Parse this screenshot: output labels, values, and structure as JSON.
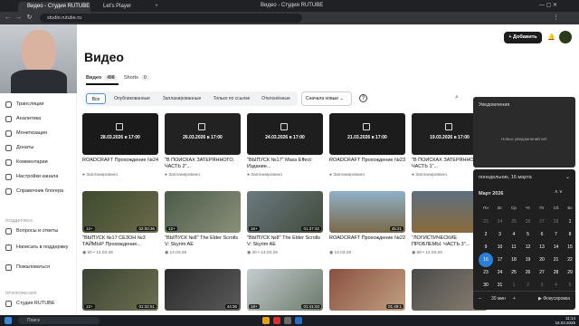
{
  "browser": {
    "tabs": [
      {
        "label": "Видео - Студия RUTUBE"
      },
      {
        "label": "Let's Player"
      }
    ],
    "address": "studio.rutube.ru",
    "page_title": "Видео - Студия RUTUBE"
  },
  "header": {
    "add_label": "+ Добавить"
  },
  "page": {
    "title": "Видео"
  },
  "subtabs": [
    {
      "label": "Видео",
      "count": "498"
    },
    {
      "label": "Shorts",
      "count": "0"
    }
  ],
  "filters": [
    "Все",
    "Опубликованные",
    "Запланированные",
    "Только по ссылке",
    "Отклонённые"
  ],
  "sort": {
    "label": "Сначала новые"
  },
  "sidebar": {
    "items": [
      "Трансляции",
      "Аналитика",
      "Монетизация",
      "Донаты",
      "Комментарии",
      "Настройки канала",
      "Справочник блогера"
    ],
    "support_head": "ПОДДЕРЖКА",
    "support": [
      "Вопросы и ответы",
      "Написать в поддержку",
      "Пожаловаться"
    ],
    "apps_head": "ПРИЛОЖЕНИЯ",
    "apps": [
      "Студия RUTUBE"
    ]
  },
  "row1": [
    {
      "date": "28.03.2026 в 17:00",
      "title": "ROADCRAFT Прохождение №24",
      "meta": "● Запланировано"
    },
    {
      "date": "26.03.2026 в 17:00",
      "title": "\"В ПОИСКАХ ЗАТЕРЯННОГО. ЧАСТЬ 2\"...",
      "meta": "● Запланировано"
    },
    {
      "date": "24.03.2026 в 17:00",
      "title": "\"ВЫПУСК №17\" Mass Effect: Издание...",
      "meta": "● Запланировано"
    },
    {
      "date": "21.03.2026 в 17:00",
      "title": "ROADCRAFT Прохождение №23",
      "meta": "● Запланировано"
    },
    {
      "date": "19.03.2026 в 17:00",
      "title": "\"В ПОИСКАХ ЗАТЕРЯННОГО. ЧАСТЬ 1\"...",
      "meta": "● Запланировано"
    }
  ],
  "row2": [
    {
      "age": "12+",
      "dur": "02:00:36",
      "title": "\"ВЫПУСК №17 СЕЗОН №3 ТАЙМЫР Прохождение...",
      "meta": "◉ 50 • 14.03.26"
    },
    {
      "age": "12+",
      "dur": "",
      "title": "\"ВЫПУСК №8\" The Elder Scrolls V: Skyrim AE",
      "meta": "◉ 14.03.26"
    },
    {
      "age": "16+",
      "dur": "01:37:32",
      "title": "\"ВЫПУСК №8\" The Elder Scrolls V: Skyrim AE",
      "meta": "◉ 20 • 14.03.26"
    },
    {
      "age": "",
      "dur": "45:21",
      "title": "ROADCRAFT Прохождение №22",
      "meta": "◉ 14.03.26"
    },
    {
      "age": "",
      "dur": "",
      "title": "\"ЛОГИСТИЧЕСКИЕ ПРОБЛЕМЫ. ЧАСТЬ 3\"...",
      "meta": "◉ 59 • 12.03.26"
    }
  ],
  "row3": [
    {
      "age": "12+",
      "dur": "01:32:51"
    },
    {
      "age": "",
      "dur": "44:36"
    },
    {
      "age": "18+",
      "dur": "01:41:03"
    },
    {
      "age": "",
      "dur": "01:49:1"
    },
    {
      "age": "",
      "dur": ""
    }
  ],
  "notifications": {
    "title": "Уведомления",
    "empty": "Новых уведомлений нет"
  },
  "calendar": {
    "date_line": "понедельник, 16 марта",
    "month": "Март 2026",
    "dows": [
      "Пн",
      "Вт",
      "Ср",
      "Чт",
      "Пт",
      "Сб",
      "Вс"
    ],
    "weeks": [
      [
        "23",
        "24",
        "25",
        "26",
        "27",
        "28",
        "1"
      ],
      [
        "2",
        "3",
        "4",
        "5",
        "6",
        "7",
        "8"
      ],
      [
        "9",
        "10",
        "11",
        "12",
        "13",
        "14",
        "15"
      ],
      [
        "16",
        "17",
        "18",
        "19",
        "20",
        "21",
        "22"
      ],
      [
        "23",
        "24",
        "25",
        "26",
        "27",
        "28",
        "29"
      ],
      [
        "30",
        "31",
        "1",
        "2",
        "3",
        "4",
        "5"
      ]
    ],
    "today": "16",
    "timer": "30 мин",
    "focus": "▶ Фокусировка"
  },
  "taskbar": {
    "search": "Поиск",
    "time": "11:14",
    "date": "16.03.2026"
  },
  "colors": {
    "accent": "#2b7fd4",
    "dark": "#1c1c1c"
  }
}
